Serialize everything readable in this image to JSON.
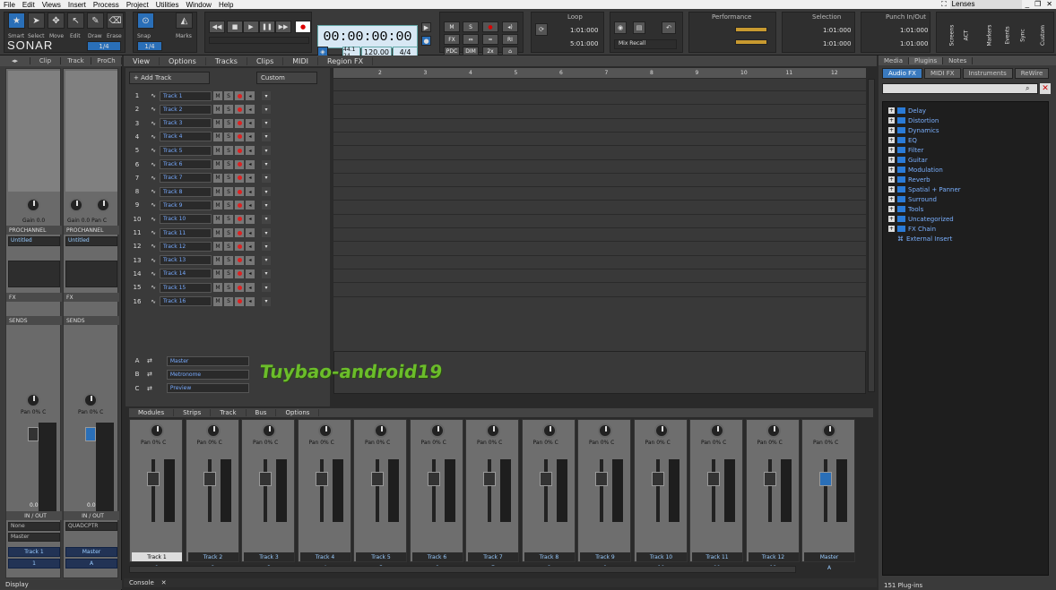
{
  "menu": [
    "File",
    "Edit",
    "Views",
    "Insert",
    "Process",
    "Project",
    "Utilities",
    "Window",
    "Help"
  ],
  "lenses": "Lenses",
  "tools": [
    {
      "label": "Smart",
      "icon": "star-icon",
      "glyph": "★"
    },
    {
      "label": "Select",
      "icon": "cursor-icon",
      "glyph": "➤"
    },
    {
      "label": "Move",
      "icon": "move-icon",
      "glyph": "✥"
    },
    {
      "label": "Edit",
      "icon": "edit-icon",
      "glyph": "↖"
    },
    {
      "label": "Draw",
      "icon": "pencil-icon",
      "glyph": "✎"
    },
    {
      "label": "Erase",
      "icon": "eraser-icon",
      "glyph": "⌫"
    }
  ],
  "brand": "SONAR",
  "snap": {
    "label": "Snap",
    "value": "1/4",
    "marks": "Marks",
    "tool_value": "1/4"
  },
  "transport": {
    "time": "00:00:00:00",
    "bpm": "120.00",
    "meter": "4/4",
    "sig": "44.1 24"
  },
  "mix_buttons": [
    "M",
    "S",
    "FX",
    "PDC",
    "DIM",
    "2x",
    "RI"
  ],
  "loop": {
    "title": "Loop",
    "start": "1:01:000",
    "end": "5:01:000"
  },
  "mix_recall": "Mix Recall",
  "performance": "Performance",
  "selection": {
    "title": "Selection",
    "start": "1:01:000",
    "end": "1:01:000"
  },
  "punch": {
    "title": "Punch In/Out",
    "start": "1:01:000",
    "end": "1:01:000"
  },
  "right_tabs": [
    "Screens",
    "ACT",
    "Markers",
    "Events",
    "Sync",
    "Custom"
  ],
  "left_tabs": [
    "Clip",
    "Track",
    "ProCh"
  ],
  "left_strips": [
    {
      "gain": "Gain 0.0",
      "prochannel": "PROCHANNEL",
      "preset": "Untitled",
      "fx": "FX",
      "sends": "SENDS",
      "pan": "Pan 0% C",
      "io": "IN / OUT",
      "in": "None",
      "out": "Master",
      "name": "Track 1",
      "num": "1",
      "level": "0.0"
    },
    {
      "gain": "Gain 0.0 Pan C",
      "prochannel": "PROCHANNEL",
      "preset": "Untitled",
      "fx": "FX",
      "sends": "SENDS",
      "pan": "Pan 0% C",
      "io": "IN / OUT",
      "in": "QUADCPTR",
      "out": "",
      "name": "Master",
      "num": "A",
      "level": "0.0"
    }
  ],
  "display": "Display",
  "track_menu": [
    "View",
    "Options",
    "Tracks",
    "Clips",
    "MIDI",
    "Region FX"
  ],
  "add_track": "+ Add Track",
  "custom": "Custom",
  "tracks": [
    "Track 1",
    "Track 2",
    "Track 3",
    "Track 4",
    "Track 5",
    "Track 6",
    "Track 7",
    "Track 8",
    "Track 9",
    "Track 10",
    "Track 11",
    "Track 12",
    "Track 13",
    "Track 14",
    "Track 15",
    "Track 16"
  ],
  "buses": [
    {
      "id": "A",
      "name": "Master"
    },
    {
      "id": "B",
      "name": "Metronome"
    },
    {
      "id": "C",
      "name": "Preview"
    }
  ],
  "ruler": [
    "2",
    "3",
    "4",
    "5",
    "6",
    "7",
    "8",
    "9",
    "10",
    "11",
    "12"
  ],
  "watermark": "Tuybao-android19",
  "console_menu": [
    "Modules",
    "Strips",
    "Track",
    "Bus",
    "Options"
  ],
  "console_strips": [
    {
      "name": "Track 1",
      "num": "1"
    },
    {
      "name": "Track 2",
      "num": "2"
    },
    {
      "name": "Track 3",
      "num": "3"
    },
    {
      "name": "Track 4",
      "num": "4"
    },
    {
      "name": "Track 5",
      "num": "5"
    },
    {
      "name": "Track 6",
      "num": "6"
    },
    {
      "name": "Track 7",
      "num": "7"
    },
    {
      "name": "Track 8",
      "num": "8"
    },
    {
      "name": "Track 9",
      "num": "9"
    },
    {
      "name": "Track 10",
      "num": "10"
    },
    {
      "name": "Track 11",
      "num": "11"
    },
    {
      "name": "Track 12",
      "num": "12"
    },
    {
      "name": "Master",
      "num": "A"
    }
  ],
  "pan_label": "Pan 0% C",
  "console_tab": "Console",
  "browser_tabs": [
    "Media",
    "Plugins",
    "Notes"
  ],
  "plugin_tabs": [
    "Audio FX",
    "MIDI FX",
    "Instruments",
    "ReWire"
  ],
  "plugin_tree": [
    "Delay",
    "Distortion",
    "Dynamics",
    "EQ",
    "Filter",
    "Guitar",
    "Modulation",
    "Reverb",
    "Spatial + Panner",
    "Surround",
    "Tools",
    "Uncategorized",
    "FX Chain",
    "External Insert"
  ],
  "plugin_count": "151 Plug-ins"
}
